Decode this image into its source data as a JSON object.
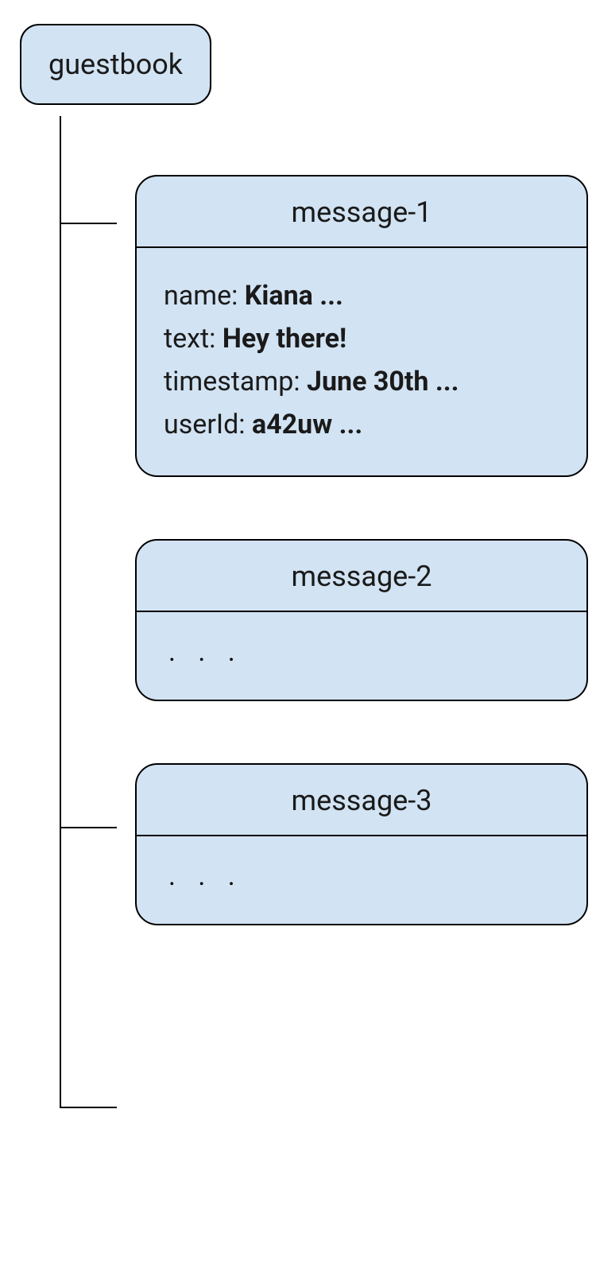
{
  "root": {
    "label": "guestbook"
  },
  "documents": [
    {
      "title": "message-1",
      "fields": [
        {
          "key": "name",
          "value": "Kiana ..."
        },
        {
          "key": "text",
          "value": "Hey there!"
        },
        {
          "key": "timestamp",
          "value": "June 30th ..."
        },
        {
          "key": "userId",
          "value": "a42uw ..."
        }
      ]
    },
    {
      "title": "message-2",
      "body_ellipsis": ". . ."
    },
    {
      "title": "message-3",
      "body_ellipsis": ". . ."
    }
  ]
}
